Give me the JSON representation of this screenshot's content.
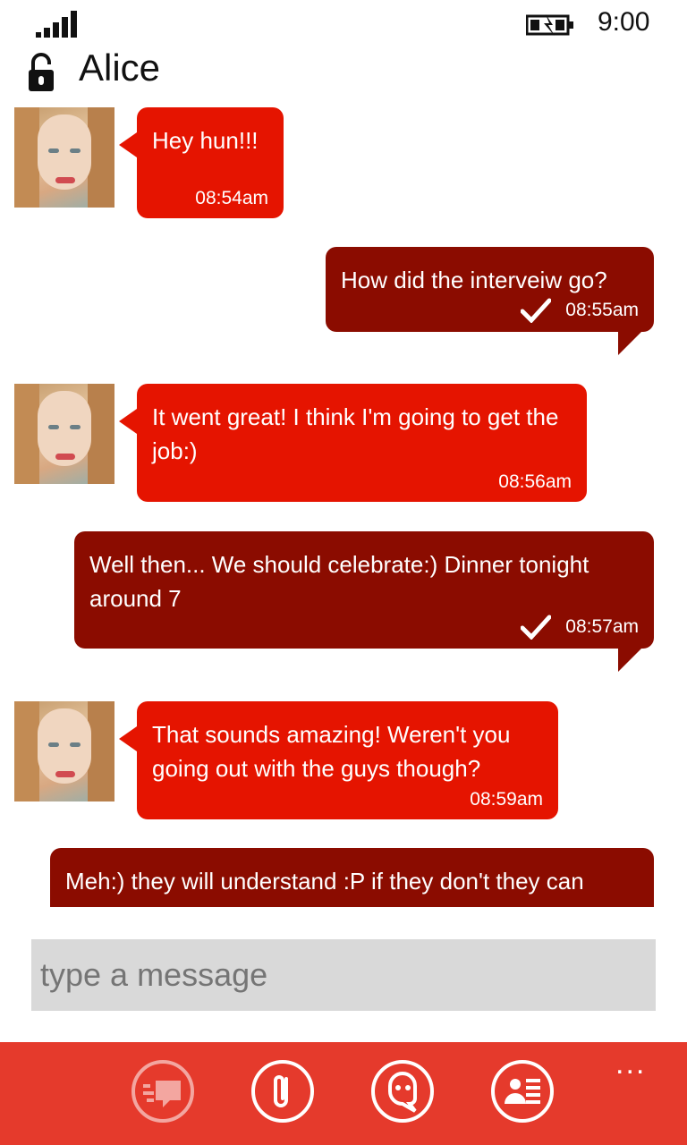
{
  "status_bar": {
    "time": "9:00",
    "signal_icon": "signal-bars-icon",
    "battery_icon": "battery-charging-icon"
  },
  "header": {
    "lock_icon": "unlocked-padlock-icon",
    "contact_name": "Alice"
  },
  "messages": [
    {
      "direction": "incoming",
      "text": "Hey hun!!!",
      "time": "08:54am"
    },
    {
      "direction": "outgoing",
      "text": "How did the interveiw go?",
      "time": "08:55am",
      "delivered": true
    },
    {
      "direction": "incoming",
      "text": "It went great! I think I'm going to get the job:)",
      "time": "08:56am"
    },
    {
      "direction": "outgoing",
      "text": "Well then... We should celebrate:) Dinner tonight around 7",
      "time": "08:57am",
      "delivered": true
    },
    {
      "direction": "incoming",
      "text": "That sounds amazing! Weren't you going out with the guys though?",
      "time": "08:59am"
    },
    {
      "direction": "outgoing",
      "text": "Meh:) they will understand :P if they don't they can"
    }
  ],
  "composer": {
    "placeholder": "type a message"
  },
  "app_bar": {
    "buttons": [
      "chat-bubbles-icon",
      "paperclip-icon",
      "emoticon-icon",
      "contact-card-icon"
    ],
    "more_label": "..."
  },
  "colors": {
    "incoming": "#e51400",
    "outgoing": "#8b0c00",
    "app_bar": "#e53a2c",
    "input_bg": "#d9d9d9"
  }
}
